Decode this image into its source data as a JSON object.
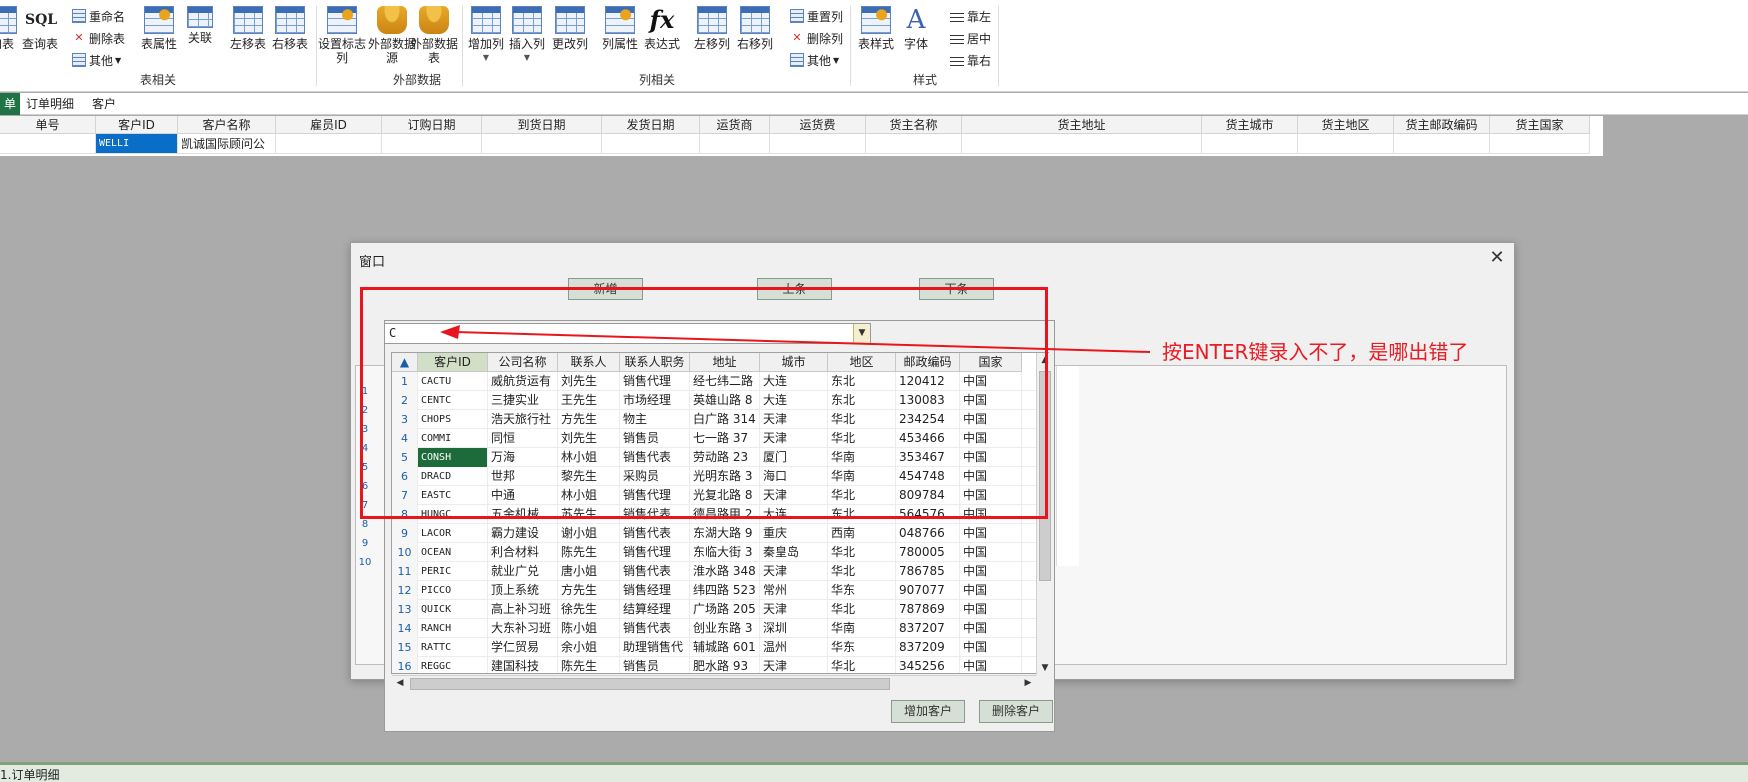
{
  "ribbon": {
    "partial_left_label": "加表",
    "query_label": "查询表",
    "sql_text": "SQL",
    "rename_label": "重命名",
    "delete_table_label": "删除表",
    "other_label": "其他",
    "table_props_label": "表属性",
    "relation_label": "关联",
    "move_left_table_label": "左移表",
    "move_right_table_label": "右移表",
    "set_identity_label": "设置标志列",
    "ext_datasource_label": "外部数据源",
    "ext_datatable_label": "外部数据表",
    "add_column_label": "增加列",
    "insert_column_label": "插入列",
    "change_column_label": "更改列",
    "column_props_label": "列属性",
    "expression_label": "表达式",
    "fx_text": "fx",
    "move_left_col_label": "左移列",
    "move_right_col_label": "右移列",
    "reset_columns_label": "重置列",
    "delete_column_label": "删除列",
    "other2_label": "其他",
    "table_style_label": "表样式",
    "font_label": "字体",
    "font_glyph": "A",
    "align_left_label": "靠左",
    "align_center_label": "居中",
    "align_right_label": "靠右",
    "group_table": "表相关",
    "group_external": "外部数据",
    "group_column": "列相关",
    "group_style": "样式"
  },
  "tabs": [
    {
      "label": "单",
      "active": true
    },
    {
      "label": "订单明细",
      "active": false
    },
    {
      "label": "客户",
      "active": false
    }
  ],
  "sheet": {
    "headers": [
      "单号",
      "客户ID",
      "客户名称",
      "雇员ID",
      "订购日期",
      "到货日期",
      "发货日期",
      "运货商",
      "运货费",
      "货主名称",
      "货主地址",
      "货主城市",
      "货主地区",
      "货主邮政编码",
      "货主国家"
    ],
    "row": [
      "",
      "WELLI",
      "凯诚国际顾问公",
      "",
      "",
      "",
      "",
      "",
      "",
      "",
      "",
      "",
      "",
      "",
      ""
    ]
  },
  "dialog": {
    "title": "窗口",
    "new_label": "新增",
    "prev_label": "上条",
    "next_label": "下条",
    "bg_row_numbers": [
      "1",
      "2",
      "3",
      "4",
      "5",
      "6",
      "7",
      "8",
      "9",
      "10"
    ]
  },
  "combo": {
    "value": "C"
  },
  "customer_grid": {
    "columns": [
      "客户ID",
      "公司名称",
      "联系人",
      "联系人职务",
      "地址",
      "城市",
      "地区",
      "邮政编码",
      "国家"
    ],
    "rows": [
      [
        "1",
        "CACTU",
        "威航货运有",
        "刘先生",
        "销售代理",
        "经七纬二路",
        "大连",
        "东北",
        "120412",
        "中国"
      ],
      [
        "2",
        "CENTC",
        "三捷实业",
        "王先生",
        "市场经理",
        "英雄山路 8",
        "大连",
        "东北",
        "130083",
        "中国"
      ],
      [
        "3",
        "CHOPS",
        "浩天旅行社",
        "方先生",
        "物主",
        "白广路 314",
        "天津",
        "华北",
        "234254",
        "中国"
      ],
      [
        "4",
        "COMMI",
        "同恒",
        "刘先生",
        "销售员",
        "七一路 37",
        "天津",
        "华北",
        "453466",
        "中国"
      ],
      [
        "5",
        "CONSH",
        "万海",
        "林小姐",
        "销售代表",
        "劳动路 23",
        "厦门",
        "华南",
        "353467",
        "中国"
      ],
      [
        "6",
        "DRACD",
        "世邦",
        "黎先生",
        "采购员",
        "光明东路 3",
        "海口",
        "华南",
        "454748",
        "中国"
      ],
      [
        "7",
        "EASTC",
        "中通",
        "林小姐",
        "销售代理",
        "光复北路 8",
        "天津",
        "华北",
        "809784",
        "中国"
      ],
      [
        "8",
        "HUNGC",
        "五金机械",
        "苏先生",
        "销售代表",
        "德昌路甲 2",
        "大连",
        "东北",
        "564576",
        "中国"
      ],
      [
        "9",
        "LACOR",
        "霸力建设",
        "谢小姐",
        "销售代表",
        "东湖大路 9",
        "重庆",
        "西南",
        "048766",
        "中国"
      ],
      [
        "10",
        "OCEAN",
        "利合材料",
        "陈先生",
        "销售代理",
        "东临大街 3",
        "秦皇岛",
        "华北",
        "780005",
        "中国"
      ],
      [
        "11",
        "PERIC",
        "就业广兑",
        "唐小姐",
        "销售代表",
        "淮水路 348",
        "天津",
        "华北",
        "786785",
        "中国"
      ],
      [
        "12",
        "PICCO",
        "顶上系统",
        "方先生",
        "销售经理",
        "纬四路 523",
        "常州",
        "华东",
        "907077",
        "中国"
      ],
      [
        "13",
        "QUICK",
        "高上补习班",
        "徐先生",
        "结算经理",
        "广场路 205",
        "天津",
        "华北",
        "787869",
        "中国"
      ],
      [
        "14",
        "RANCH",
        "大东补习班",
        "陈小姐",
        "销售代表",
        "创业东路 3",
        "深圳",
        "华南",
        "837207",
        "中国"
      ],
      [
        "15",
        "RATTC",
        "学仁贸易",
        "余小姐",
        "助理销售代",
        "辅城路 601",
        "温州",
        "华东",
        "837209",
        "中国"
      ],
      [
        "16",
        "REGGC",
        "建国科技",
        "陈先生",
        "销售员",
        "肥水路 93",
        "天津",
        "华北",
        "345256",
        "中国"
      ]
    ],
    "highlighted_row_index": 4
  },
  "panel_buttons": {
    "add_customer": "增加客户",
    "delete_customer": "删除客户"
  },
  "annotation": {
    "text": "按ENTER键录入不了，是哪出错了",
    "color": "#e8161c"
  },
  "status": {
    "text": "1.订单明细"
  },
  "colors": {
    "accent_green": "#217346",
    "selection_blue": "#0a6ec8",
    "highlight_green": "#1d6b3a"
  }
}
